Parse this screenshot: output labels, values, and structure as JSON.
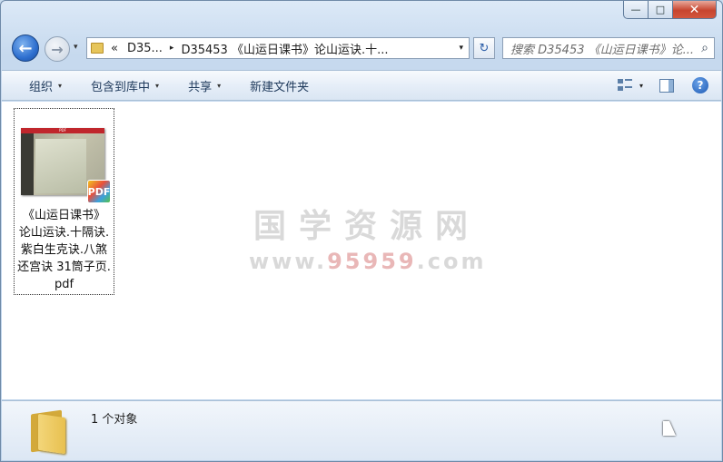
{
  "window": {
    "minimize_glyph": "—",
    "maximize_glyph": "□",
    "close_glyph": "✕"
  },
  "nav": {
    "back_glyph": "←",
    "forward_glyph": "→",
    "history_glyph": "▾",
    "breadcrumb_overflow": "«",
    "crumb_1": "D35...",
    "crumb_sep": "▸",
    "crumb_2": "D35453 《山运日课书》论山运诀.十...",
    "address_dropdown_glyph": "▾",
    "refresh_glyph": "↻",
    "search_placeholder": "搜索 D35453 《山运日课书》论...",
    "search_icon": "search-icon",
    "search_glyph": "⌕"
  },
  "toolbar": {
    "organize": "组织",
    "include_in_library": "包含到库中",
    "share": "共享",
    "new_folder": "新建文件夹",
    "arrow_glyph": "▾",
    "help_glyph": "?"
  },
  "files": [
    {
      "thumb_label": "PDF",
      "badge": "PDF",
      "name_lines": [
        "《山运日课书》",
        "论山运诀.十隔诀.",
        "紫白生克诀.八煞",
        "还宫诀 31筒子页.",
        "pdf"
      ]
    }
  ],
  "watermark": {
    "title": "国学资源网",
    "url_prefix": "www.",
    "url_highlight": "95959",
    "url_suffix": ".com"
  },
  "status": {
    "count_text": "1 个对象"
  },
  "colors": {
    "accent": "#1e395b",
    "close_red": "#c7452f",
    "pdf_red": "#c0262c"
  }
}
